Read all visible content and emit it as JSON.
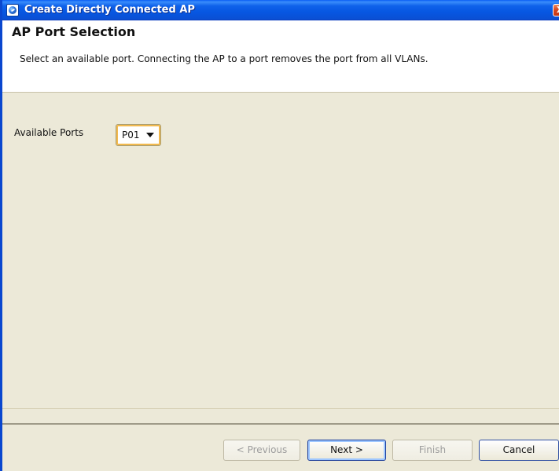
{
  "window": {
    "title": "Create Directly Connected AP",
    "icon": "app-network-icon",
    "close_label": "X",
    "accent_color": "#0A5FF5"
  },
  "header": {
    "title": "AP Port Selection",
    "description": "Select an available port.  Connecting the AP to a port removes the port from all VLANs."
  },
  "form": {
    "available_ports_label": "Available Ports",
    "port_value": "P01",
    "dropdown_icon": "chevron-down-icon"
  },
  "footer": {
    "previous_label": "< Previous",
    "next_label": "Next >",
    "finish_label": "Finish",
    "cancel_label": "Cancel"
  }
}
